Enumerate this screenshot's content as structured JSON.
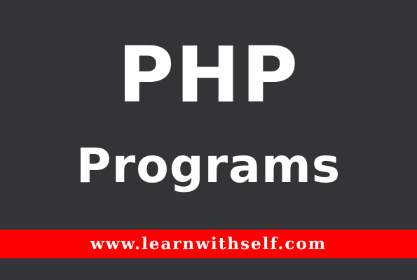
{
  "title": {
    "main": "PHP",
    "sub": "Programs"
  },
  "banner": {
    "url": "www.learnwithself.com"
  },
  "colors": {
    "background": "#333436",
    "banner": "#fe0000",
    "text": "#ffffff"
  }
}
